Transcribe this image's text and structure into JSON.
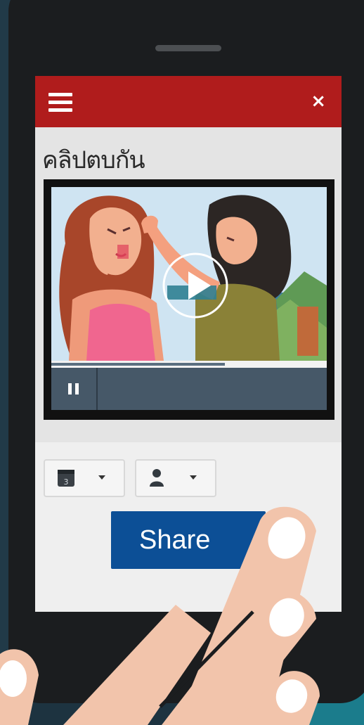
{
  "header": {
    "menu_icon": "hamburger-menu-icon",
    "close_label": "×"
  },
  "video": {
    "title": "คลิปตบกัน",
    "progress": 0.63,
    "play_icon": "play-icon",
    "pause_icon": "pause-icon"
  },
  "toolbar": {
    "calendar_dropdown": {
      "icon": "calendar-icon",
      "day": "3"
    },
    "user_dropdown": {
      "icon": "user-icon"
    },
    "share_label": "Share"
  },
  "colors": {
    "header_red": "#b01c1c",
    "share_blue": "#0c4f96",
    "player_controls": "#465868"
  }
}
